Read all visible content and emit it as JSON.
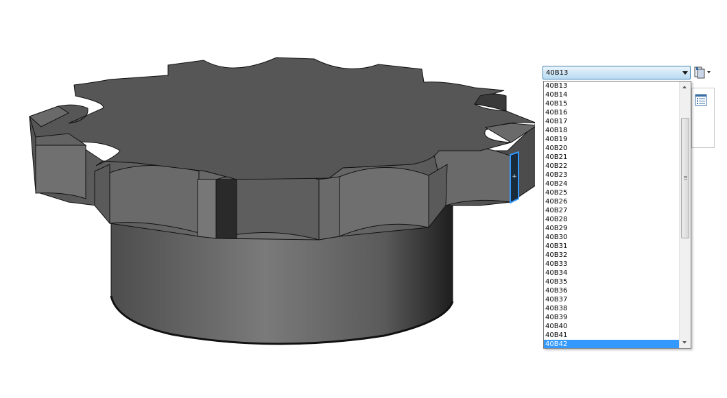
{
  "combo": {
    "selected": "40B13"
  },
  "dropdown": {
    "options": [
      "40B13",
      "40B14",
      "40B15",
      "40B16",
      "40B17",
      "40B18",
      "40B19",
      "40B20",
      "40B21",
      "40B22",
      "40B23",
      "40B24",
      "40B25",
      "40B26",
      "40B27",
      "40B28",
      "40B29",
      "40B30",
      "40B31",
      "40B32",
      "40B33",
      "40B34",
      "40B35",
      "40B36",
      "40B37",
      "40B38",
      "40B39",
      "40B40",
      "40B41",
      "40B42"
    ],
    "highlighted": "40B42"
  },
  "viewport": {
    "model_icon": "sprocket-model",
    "colors": {
      "body": "#5a5a5a",
      "highlight": "#3399ff"
    }
  }
}
